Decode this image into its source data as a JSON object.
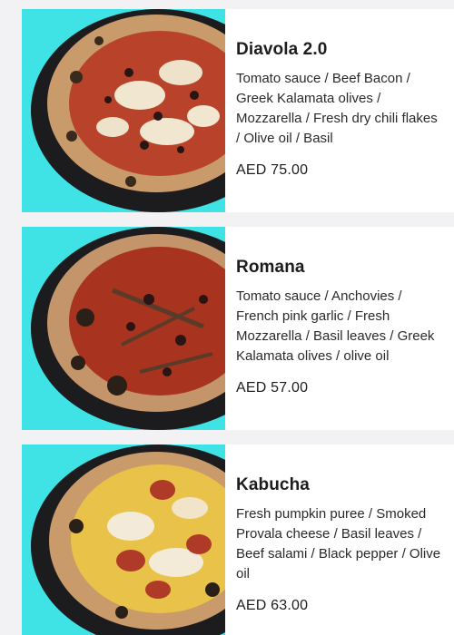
{
  "menu": {
    "items": [
      {
        "name": "Diavola 2.0",
        "description": "Tomato sauce / Beef Bacon / Greek Kalamata olives / Mozzarella / Fresh dry chili flakes / Olive oil / Basil",
        "price": "AED 75.00",
        "image": "pizza-diavola-photo"
      },
      {
        "name": "Romana",
        "description": "Tomato sauce / Anchovies / French pink garlic / Fresh Mozzarella / Basil leaves / Greek Kalamata olives / olive oil",
        "price": "AED 57.00",
        "image": "pizza-romana-photo"
      },
      {
        "name": "Kabucha",
        "description": "Fresh pumpkin puree / Smoked Provala cheese / Basil leaves / Beef salami / Black pepper / Olive oil",
        "price": "AED 63.00",
        "image": "pizza-kabucha-photo"
      }
    ]
  },
  "colors": {
    "page_background": "#f2f2f4",
    "card_background": "#ffffff",
    "photo_background": "#3fe3e6",
    "text_primary": "#1d1d1f"
  }
}
